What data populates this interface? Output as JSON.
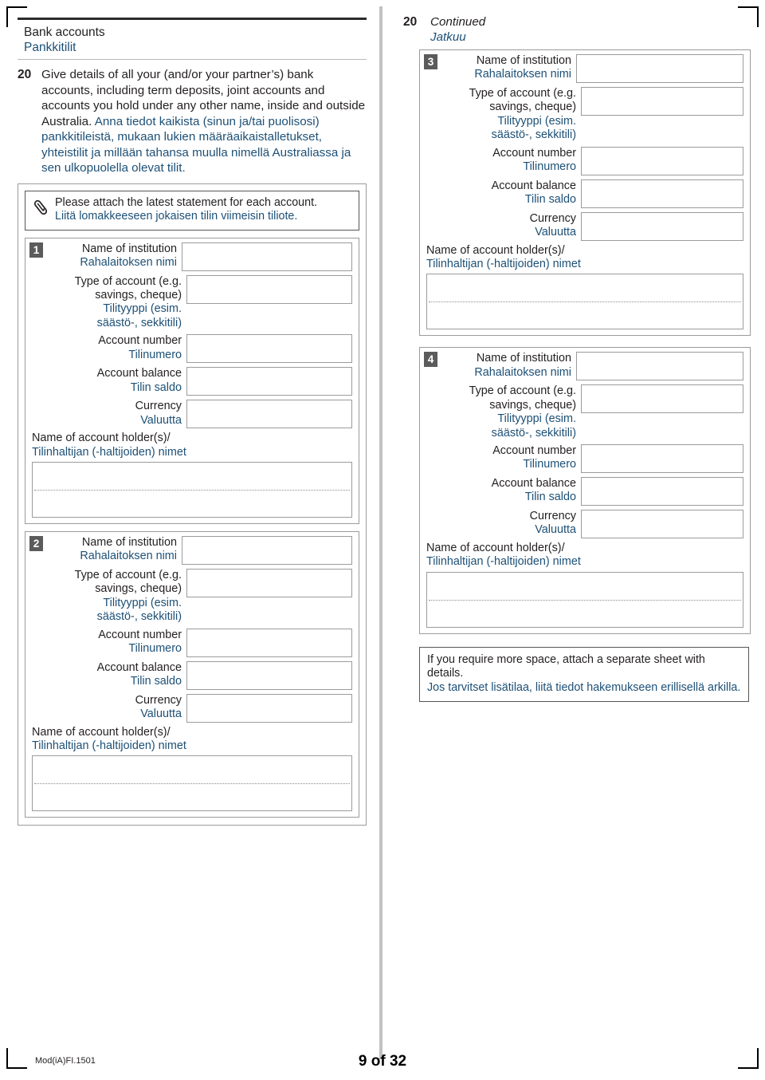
{
  "section": {
    "title_en": "Bank accounts",
    "title_fi": "Pankkitilit"
  },
  "question": {
    "number": "20",
    "text_en": "Give details of all your (and/or your partner’s) bank accounts, including term deposits, joint accounts and accounts you hold under any other name, inside and outside Australia.",
    "text_fi": "Anna tiedot kaikista (sinun ja/tai puolisosi) pankkitileistä, mukaan lukien määräaikaistalletukset, yhteistilit ja millään tahansa muulla nimellä Australiassa ja sen ulkopuolella olevat tilit."
  },
  "attach_note": {
    "icon": "paperclip-icon",
    "text_en": "Please attach the latest statement for each account.",
    "text_fi": "Liitä lomakkeeseen jokaisen tilin viimeisin tiliote."
  },
  "continued": {
    "number": "20",
    "label_en": "Continued",
    "label_fi": "Jatkuu"
  },
  "labels": {
    "institution_en": "Name of institution",
    "institution_fi": "Rahalaitoksen nimi",
    "type_en_line1": "Type of account (e.g.",
    "type_en_line2": "savings, cheque)",
    "type_fi_line1": "Tilityyppi (esim.",
    "type_fi_line2": "säästö-, sekkitili)",
    "number_en": "Account number",
    "number_fi": "Tilinumero",
    "balance_en": "Account balance",
    "balance_fi": "Tilin saldo",
    "currency_en": "Currency",
    "currency_fi": "Valuutta",
    "holder_en": "Name of account holder(s)/",
    "holder_fi": "Tilinhaltijan (-haltijoiden) nimet"
  },
  "accounts": [
    {
      "marker": "1",
      "institution": "",
      "type": "",
      "number": "",
      "balance": "",
      "currency": "",
      "holder": ""
    },
    {
      "marker": "2",
      "institution": "",
      "type": "",
      "number": "",
      "balance": "",
      "currency": "",
      "holder": ""
    },
    {
      "marker": "3",
      "institution": "",
      "type": "",
      "number": "",
      "balance": "",
      "currency": "",
      "holder": ""
    },
    {
      "marker": "4",
      "institution": "",
      "type": "",
      "number": "",
      "balance": "",
      "currency": "",
      "holder": ""
    }
  ],
  "more_space": {
    "text_en": "If you require more space, attach a separate sheet with details.",
    "text_fi": "Jos tarvitset lisätilaa, liitä tiedot hakemukseen erillisellä arkilla."
  },
  "footer": {
    "form_code": "Mod(iA)FI.1501",
    "page": "9 of 32"
  },
  "colors": {
    "finnish_text": "#1d5076",
    "english_text": "#231f20",
    "field_border": "#9b9b9b",
    "marker_bg": "#5b5b5b",
    "divider": "#c2c2c2"
  }
}
